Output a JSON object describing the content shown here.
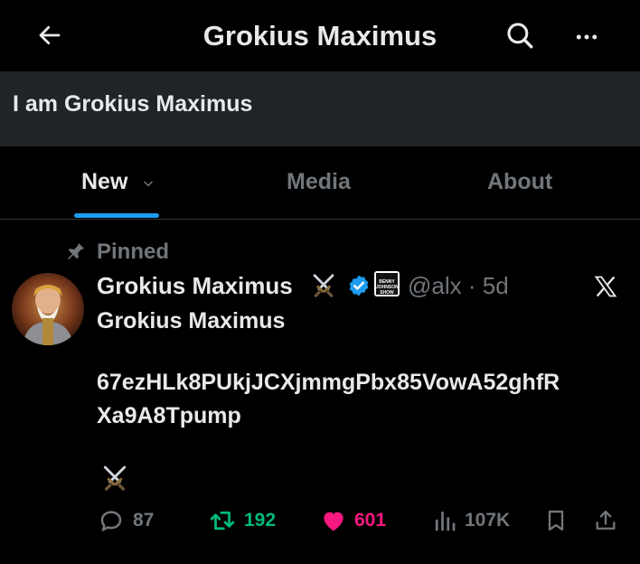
{
  "header": {
    "title": "Grokius Maximus",
    "back_icon": "arrow-left-icon",
    "search_icon": "search-icon",
    "more_icon": "more-horizontal-icon"
  },
  "bio": {
    "text": "I am Grokius Maximus"
  },
  "tabs": [
    {
      "label": "New",
      "active": true
    },
    {
      "label": "Media",
      "active": false
    },
    {
      "label": "About",
      "active": false
    }
  ],
  "post": {
    "pinned_label": "Pinned",
    "author_name": "Grokius Maximus",
    "handle": "@alx",
    "separator": "·",
    "age": "5d",
    "lines": [
      "Grokius Maximus",
      "67ezHLk8PUkjJCXjmmgPbx85VowA52ghfR",
      "Xa9A8Tpump"
    ],
    "affiliate_badge_text": "BENNY JOHNSON SHOW",
    "stats": {
      "replies": "87",
      "reposts": "192",
      "likes": "601",
      "views": "107K"
    }
  },
  "colors": {
    "accent": "#1d9bf0",
    "repost": "#00ba7c",
    "like": "#f91880",
    "muted": "#71767b",
    "bio_bg": "#202327"
  }
}
